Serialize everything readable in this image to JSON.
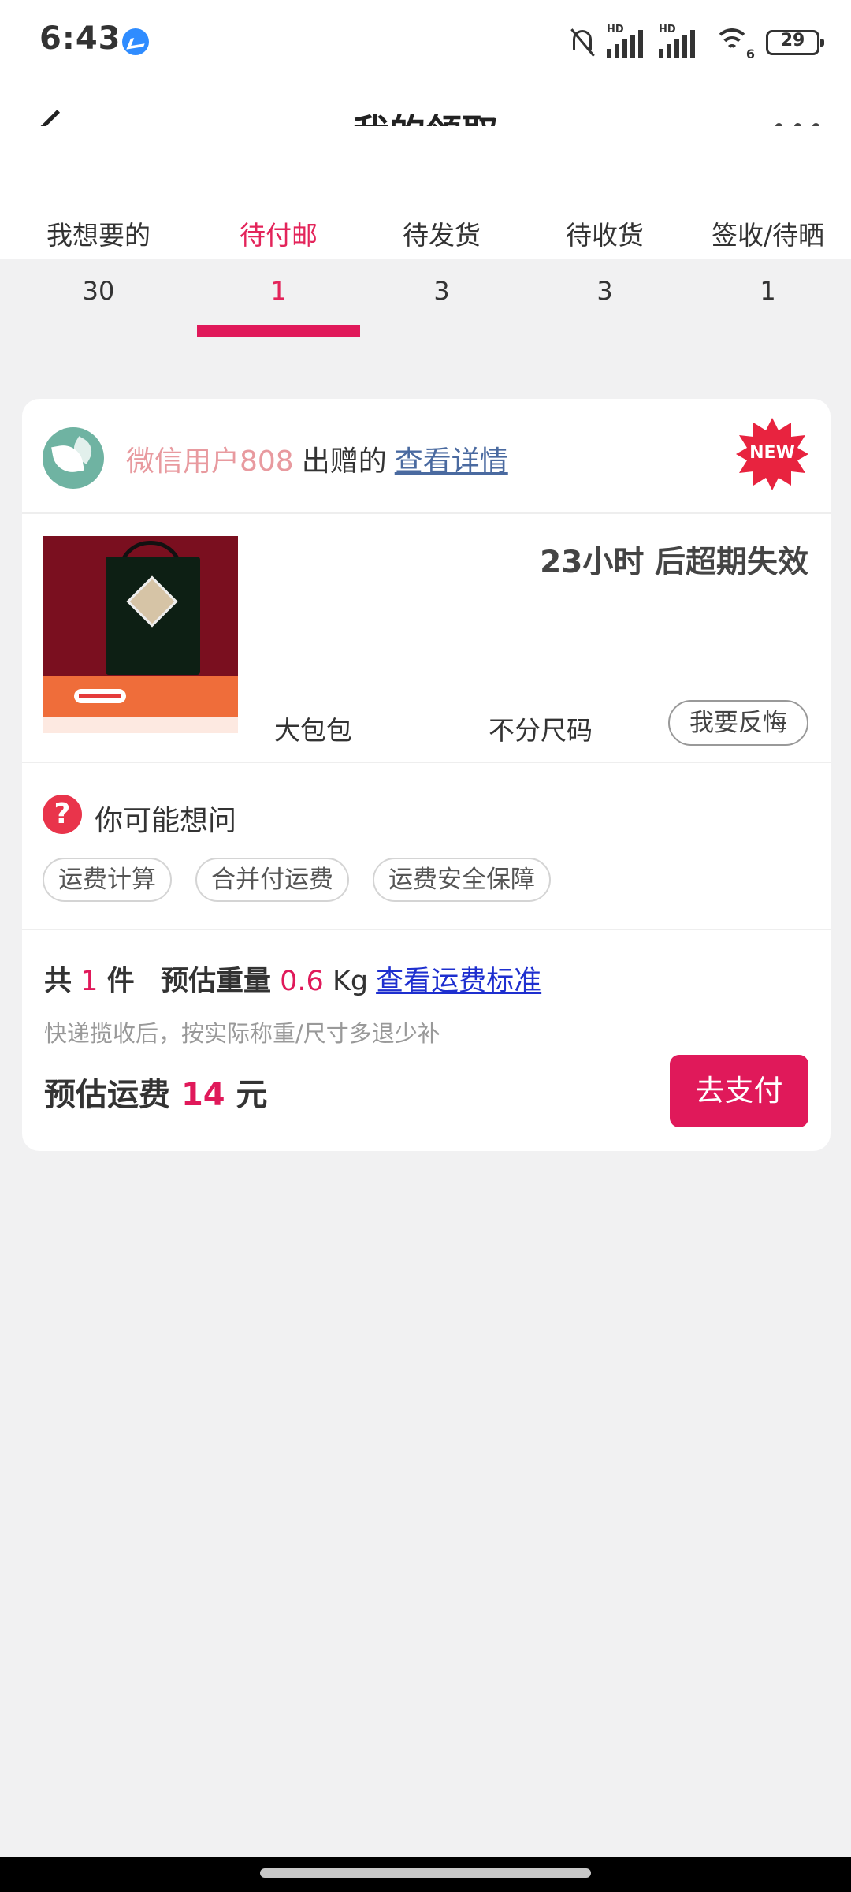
{
  "status_bar": {
    "time": "6:43",
    "battery": "29",
    "signal_label_1": "HD",
    "signal_label_2": "HD",
    "wifi_sub": "6",
    "icons": [
      "messenger-icon",
      "bell-muted-icon",
      "signal-icon",
      "wifi-icon",
      "battery-icon"
    ]
  },
  "header": {
    "title": "我的领取",
    "back_icon": "chevron-left-icon",
    "more_icon": "more-dots-icon"
  },
  "tabs": [
    {
      "label": "我想要的",
      "count": "30",
      "active": false
    },
    {
      "label": "待付邮",
      "count": "1",
      "active": true
    },
    {
      "label": "待发货",
      "count": "3",
      "active": false
    },
    {
      "label": "待收货",
      "count": "3",
      "active": false
    },
    {
      "label": "签收/待晒",
      "count": "1",
      "active": false
    }
  ],
  "card": {
    "giver_name": "微信用户808",
    "giver_verb": "出赠的",
    "detail_link": "查看详情",
    "new_badge": "NEW",
    "expiry": "23小时 后超期失效",
    "product_name": "大包包",
    "product_size": "不分尺码",
    "regret_button": "我要反悔",
    "faq_title": "你可能想问",
    "faq_icon": "?",
    "chips": [
      "运费计算",
      "合并付运费",
      "运费安全保障"
    ],
    "count_prefix": "共",
    "count_value": "1",
    "count_suffix": "件",
    "weight_label": "预估重量",
    "weight_value": "0.6",
    "weight_unit": "Kg",
    "standard_link": "查看运费标准",
    "note": "快递揽收后，按实际称重/尺寸多退少补",
    "fee_label": "预估运费",
    "fee_value": "14",
    "fee_unit": "元",
    "pay_button": "去支付"
  },
  "colors": {
    "accent": "#e0195a",
    "giver_name": "#e89a9f",
    "link": "#1e2fcf",
    "background": "#f1f1f2"
  }
}
